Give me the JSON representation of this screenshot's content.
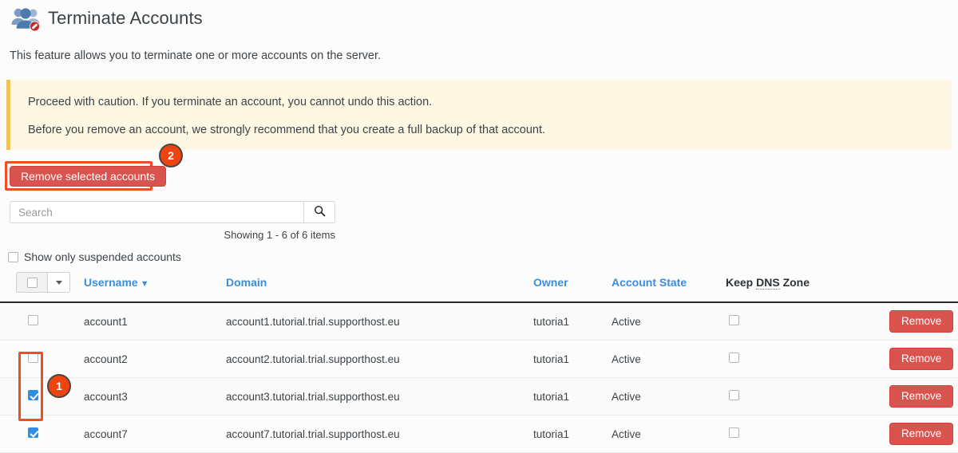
{
  "header": {
    "title": "Terminate Accounts",
    "icon": "users-blocked-icon"
  },
  "intro": "This feature allows you to terminate one or more accounts on the server.",
  "callout": {
    "line1": "Proceed with caution. If you terminate an account, you cannot undo this action.",
    "line2": "Before you remove an account, we strongly recommend that you create a full backup of that account."
  },
  "toolbar": {
    "remove_selected_label": "Remove selected accounts"
  },
  "markers": {
    "one": "1",
    "two": "2"
  },
  "search": {
    "placeholder": "Search",
    "value": "",
    "icon": "search-icon"
  },
  "showing": "Showing 1 - 6 of 6 items",
  "filter": {
    "suspended_label": "Show only suspended accounts"
  },
  "table": {
    "columns": {
      "select": "",
      "username": "Username",
      "username_sort": "▼",
      "domain": "Domain",
      "owner": "Owner",
      "account_state": "Account State",
      "keep_dns_prefix": "Keep ",
      "keep_dns_abbr": "DNS",
      "keep_dns_suffix": " Zone"
    },
    "rows": [
      {
        "selected": false,
        "username": "account1",
        "domain": "account1.tutorial.trial.supporthost.eu",
        "owner": "tutoria1",
        "state": "Active",
        "keep_dns": false,
        "action": "Remove"
      },
      {
        "selected": false,
        "username": "account2",
        "domain": "account2.tutorial.trial.supporthost.eu",
        "owner": "tutoria1",
        "state": "Active",
        "keep_dns": false,
        "action": "Remove"
      },
      {
        "selected": true,
        "username": "account3",
        "domain": "account3.tutorial.trial.supporthost.eu",
        "owner": "tutoria1",
        "state": "Active",
        "keep_dns": false,
        "action": "Remove"
      },
      {
        "selected": true,
        "username": "account7",
        "domain": "account7.tutorial.trial.supporthost.eu",
        "owner": "tutoria1",
        "state": "Active",
        "keep_dns": false,
        "action": "Remove"
      }
    ]
  },
  "colors": {
    "danger": "#d9534f",
    "highlight": "#f04e23",
    "link": "#3b8ddd",
    "callout_bg": "#fdf7e3",
    "callout_border": "#f0c457",
    "checkbox_checked": "#2f8de4"
  }
}
